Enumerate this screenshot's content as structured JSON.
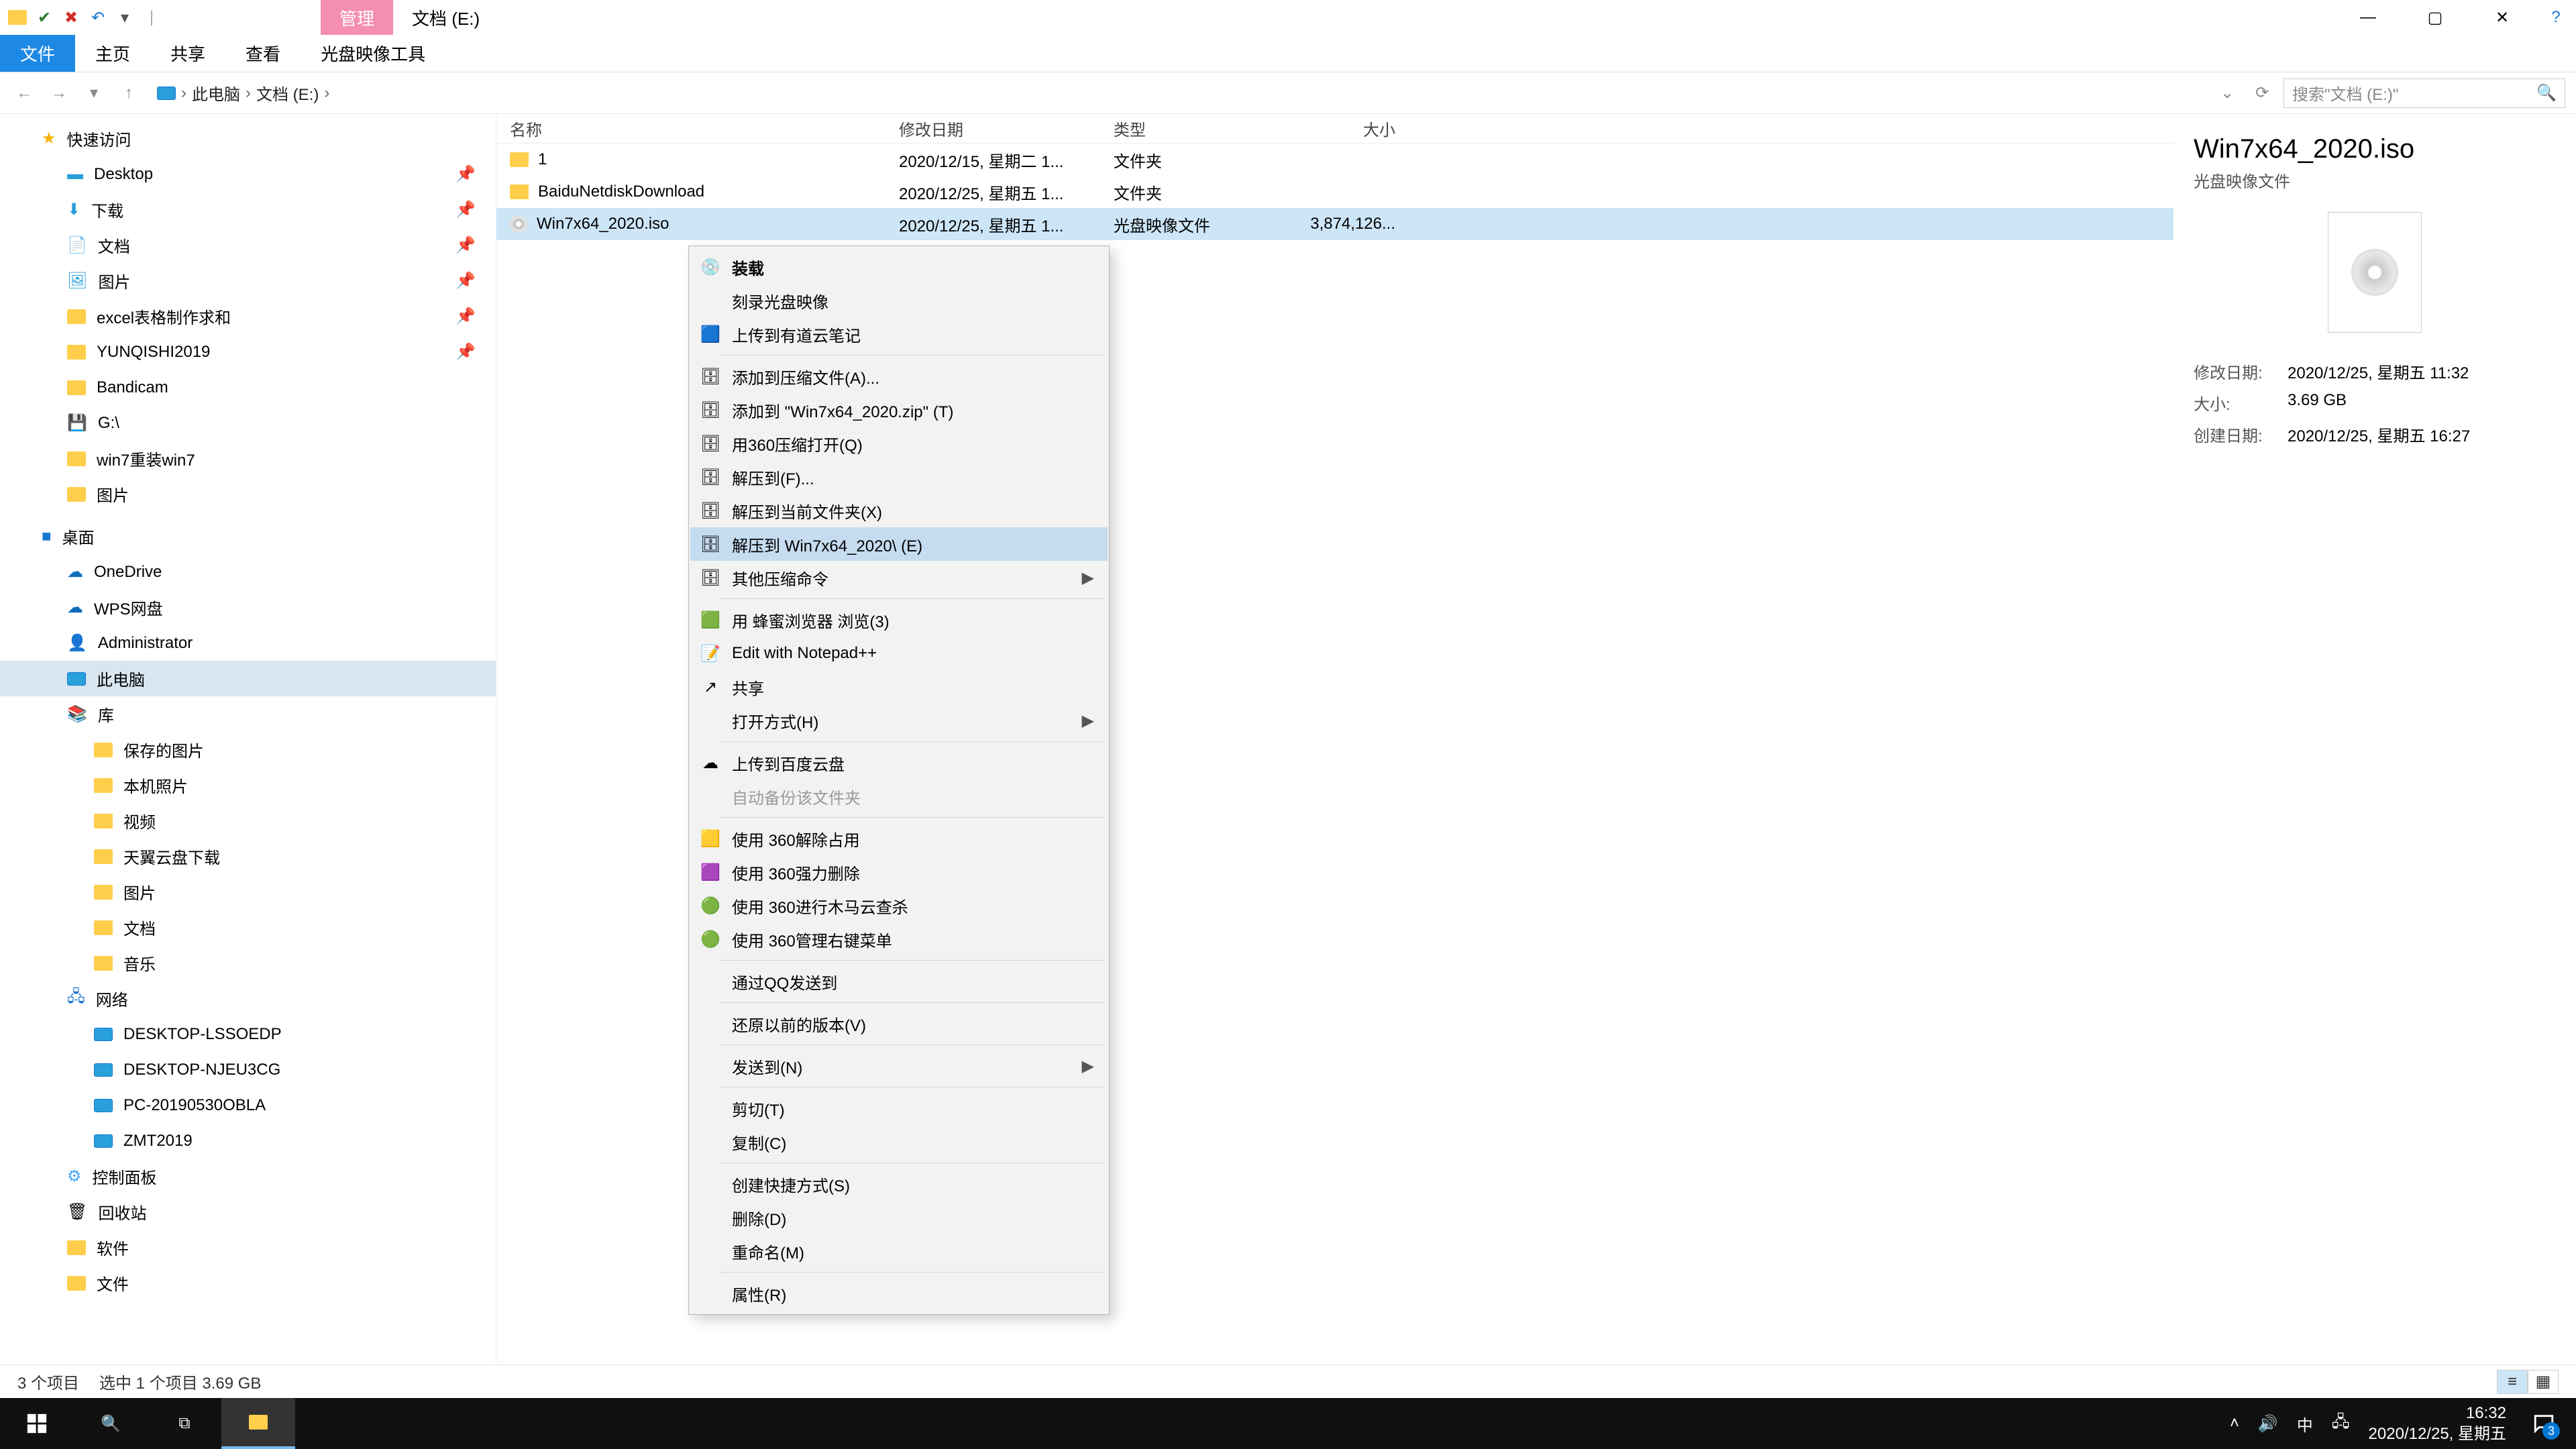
{
  "title": {
    "tab_manage": "管理",
    "tab_location": "文档 (E:)"
  },
  "ribbon": {
    "file": "文件",
    "home": "主页",
    "share": "共享",
    "view": "查看",
    "disc_tools": "光盘映像工具"
  },
  "breadcrumb": {
    "root": "此电脑",
    "drive": "文档 (E:)"
  },
  "search": {
    "placeholder": "搜索\"文档 (E:)\""
  },
  "nav": {
    "quick": "快速访问",
    "desktop": "Desktop",
    "downloads": "下载",
    "documents": "文档",
    "pictures_quick": "图片",
    "excel": "excel表格制作求和",
    "yunqishi": "YUNQISHI2019",
    "bandicam": "Bandicam",
    "gdrive": "G:\\",
    "win7reinstall": "win7重装win7",
    "pictures2": "图片",
    "desktop_root": "桌面",
    "onedrive": "OneDrive",
    "wps": "WPS网盘",
    "admin": "Administrator",
    "thispc": "此电脑",
    "library": "库",
    "savedpics": "保存的图片",
    "localphotos": "本机照片",
    "videos": "视频",
    "tianyi": "天翼云盘下载",
    "libpics": "图片",
    "libdocs": "文档",
    "libmusic": "音乐",
    "network": "网络",
    "pc1": "DESKTOP-LSSOEDP",
    "pc2": "DESKTOP-NJEU3CG",
    "pc3": "PC-20190530OBLA",
    "pc4": "ZMT2019",
    "control": "控制面板",
    "recycle": "回收站",
    "software": "软件",
    "filesf": "文件"
  },
  "cols": {
    "name": "名称",
    "date": "修改日期",
    "type": "类型",
    "size": "大小"
  },
  "files": [
    {
      "name": "1",
      "date": "2020/12/15, 星期二 1...",
      "type": "文件夹",
      "size": ""
    },
    {
      "name": "BaiduNetdiskDownload",
      "date": "2020/12/25, 星期五 1...",
      "type": "文件夹",
      "size": ""
    },
    {
      "name": "Win7x64_2020.iso",
      "date": "2020/12/25, 星期五 1...",
      "type": "光盘映像文件",
      "size": "3,874,126..."
    }
  ],
  "ctx": [
    {
      "t": "装载",
      "bold": true,
      "ic": "disc"
    },
    {
      "t": "刻录光盘映像"
    },
    {
      "t": "上传到有道云笔记",
      "ic": "blue"
    },
    {
      "sep": true
    },
    {
      "t": "添加到压缩文件(A)...",
      "ic": "zip"
    },
    {
      "t": "添加到 \"Win7x64_2020.zip\" (T)",
      "ic": "zip"
    },
    {
      "t": "用360压缩打开(Q)",
      "ic": "zip"
    },
    {
      "t": "解压到(F)...",
      "ic": "zip"
    },
    {
      "t": "解压到当前文件夹(X)",
      "ic": "zip"
    },
    {
      "t": "解压到 Win7x64_2020\\ (E)",
      "ic": "zip",
      "hover": true
    },
    {
      "t": "其他压缩命令",
      "ic": "zip",
      "sub": true
    },
    {
      "sep": true
    },
    {
      "t": "用 蜂蜜浏览器 浏览(3)",
      "ic": "green"
    },
    {
      "t": "Edit with Notepad++",
      "ic": "npp"
    },
    {
      "t": "共享",
      "ic": "share"
    },
    {
      "t": "打开方式(H)",
      "sub": true
    },
    {
      "sep": true
    },
    {
      "t": "上传到百度云盘",
      "ic": "baidu"
    },
    {
      "t": "自动备份该文件夹",
      "disabled": true
    },
    {
      "sep": true
    },
    {
      "t": "使用 360解除占用",
      "ic": "y360"
    },
    {
      "t": "使用 360强力删除",
      "ic": "p360"
    },
    {
      "t": "使用 360进行木马云查杀",
      "ic": "g360"
    },
    {
      "t": "使用 360管理右键菜单",
      "ic": "g360"
    },
    {
      "sep": true
    },
    {
      "t": "通过QQ发送到"
    },
    {
      "sep": true
    },
    {
      "t": "还原以前的版本(V)"
    },
    {
      "sep": true
    },
    {
      "t": "发送到(N)",
      "sub": true
    },
    {
      "sep": true
    },
    {
      "t": "剪切(T)"
    },
    {
      "t": "复制(C)"
    },
    {
      "sep": true
    },
    {
      "t": "创建快捷方式(S)"
    },
    {
      "t": "删除(D)"
    },
    {
      "t": "重命名(M)"
    },
    {
      "sep": true
    },
    {
      "t": "属性(R)"
    }
  ],
  "details": {
    "name": "Win7x64_2020.iso",
    "type": "光盘映像文件",
    "mdate_k": "修改日期:",
    "mdate_v": "2020/12/25, 星期五 11:32",
    "size_k": "大小:",
    "size_v": "3.69 GB",
    "cdate_k": "创建日期:",
    "cdate_v": "2020/12/25, 星期五 16:27"
  },
  "status": {
    "count": "3 个项目",
    "sel": "选中 1 个项目  3.69 GB"
  },
  "taskbar": {
    "time": "16:32",
    "date": "2020/12/25, 星期五",
    "ime": "中",
    "badge": "3"
  }
}
